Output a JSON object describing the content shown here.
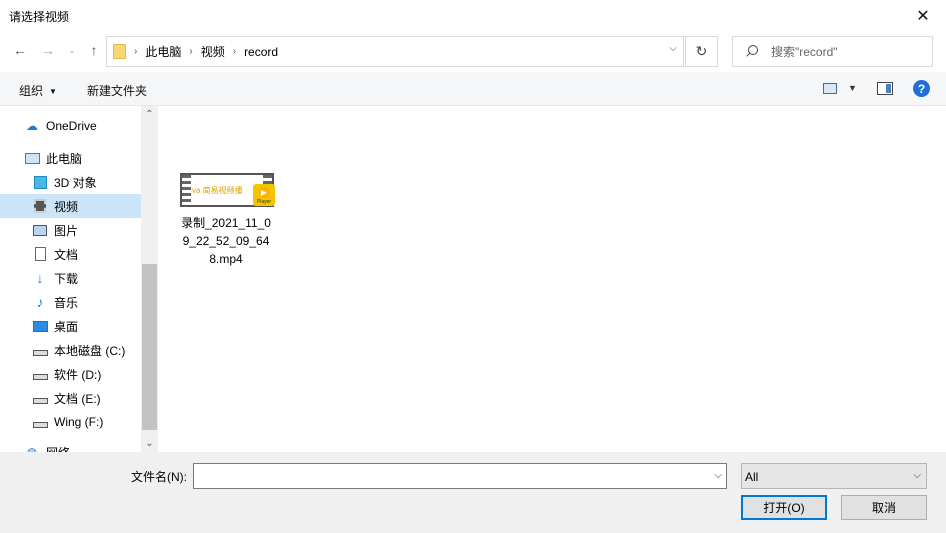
{
  "window": {
    "title": "请选择视频"
  },
  "address": {
    "breadcrumbs": [
      "此电脑",
      "视频",
      "record"
    ]
  },
  "search": {
    "placeholder": "搜索\"record\""
  },
  "toolbar": {
    "organize_label": "组织",
    "new_folder_label": "新建文件夹"
  },
  "nav": {
    "items": [
      {
        "label": "OneDrive",
        "icon": "cloud-icon"
      },
      {
        "label": "此电脑",
        "icon": "computer-icon"
      },
      {
        "label": "3D 对象",
        "icon": "cube-icon"
      },
      {
        "label": "视频",
        "icon": "video-folder-icon",
        "selected": true
      },
      {
        "label": "图片",
        "icon": "pictures-icon"
      },
      {
        "label": "文档",
        "icon": "documents-icon"
      },
      {
        "label": "下载",
        "icon": "download-icon"
      },
      {
        "label": "音乐",
        "icon": "music-icon"
      },
      {
        "label": "桌面",
        "icon": "desktop-icon"
      },
      {
        "label": "本地磁盘 (C:)",
        "icon": "drive-icon"
      },
      {
        "label": "软件 (D:)",
        "icon": "drive-icon"
      },
      {
        "label": "文档 (E:)",
        "icon": "drive-icon"
      },
      {
        "label": "Wing (F:)",
        "icon": "drive-icon"
      },
      {
        "label": "网络",
        "icon": "network-icon"
      }
    ]
  },
  "files": [
    {
      "name": "录制_2021_11_09_22_52_09_648.mp4",
      "thumb_text": "va 简易视频播",
      "badge_text": "Player"
    }
  ],
  "bottom": {
    "filename_label": "文件名(N):",
    "filename_value": "",
    "filetype_value": "All",
    "open_label": "打开(O)",
    "cancel_label": "取消"
  }
}
